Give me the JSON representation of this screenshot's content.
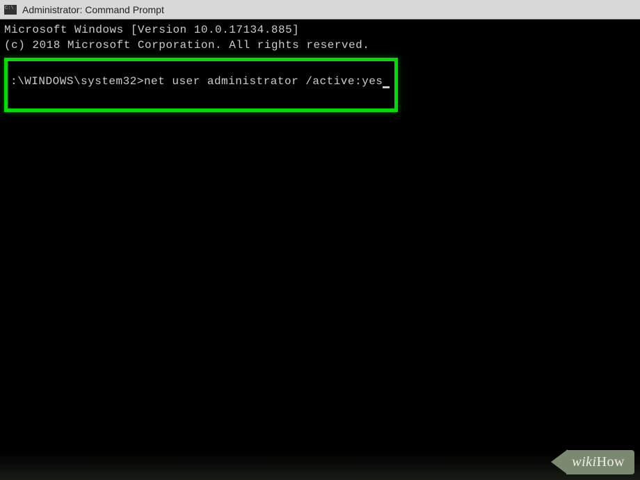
{
  "window": {
    "title": "Administrator: Command Prompt"
  },
  "terminal": {
    "line1": "Microsoft Windows [Version 10.0.17134.885]",
    "line2": "(c) 2018 Microsoft Corporation. All rights reserved.",
    "prompt": ":\\WINDOWS\\system32>",
    "command": "net user administrator /active:yes"
  },
  "watermark": {
    "text_wiki": "wiki",
    "text_how": "How"
  }
}
